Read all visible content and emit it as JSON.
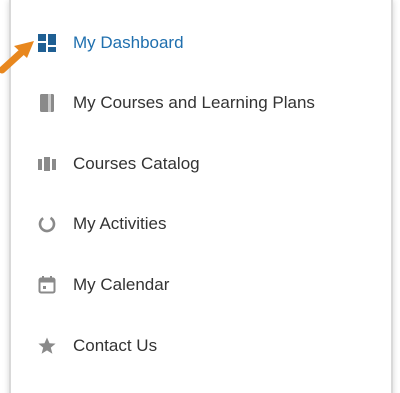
{
  "menu": {
    "items": [
      {
        "label": "My Dashboard",
        "icon": "dashboard-icon",
        "active": true
      },
      {
        "label": "My Courses and Learning Plans",
        "icon": "book-icon",
        "active": false
      },
      {
        "label": "Courses Catalog",
        "icon": "catalog-icon",
        "active": false
      },
      {
        "label": "My Activities",
        "icon": "activity-ring-icon",
        "active": false
      },
      {
        "label": "My Calendar",
        "icon": "calendar-icon",
        "active": false
      },
      {
        "label": "Contact Us",
        "icon": "star-icon",
        "active": false
      }
    ]
  },
  "colors": {
    "active_text": "#1f6fae",
    "active_icon": "#1f5f93",
    "inactive_text": "#333333",
    "inactive_icon": "#8a8a8a",
    "pointer_arrow": "#e8871e"
  }
}
